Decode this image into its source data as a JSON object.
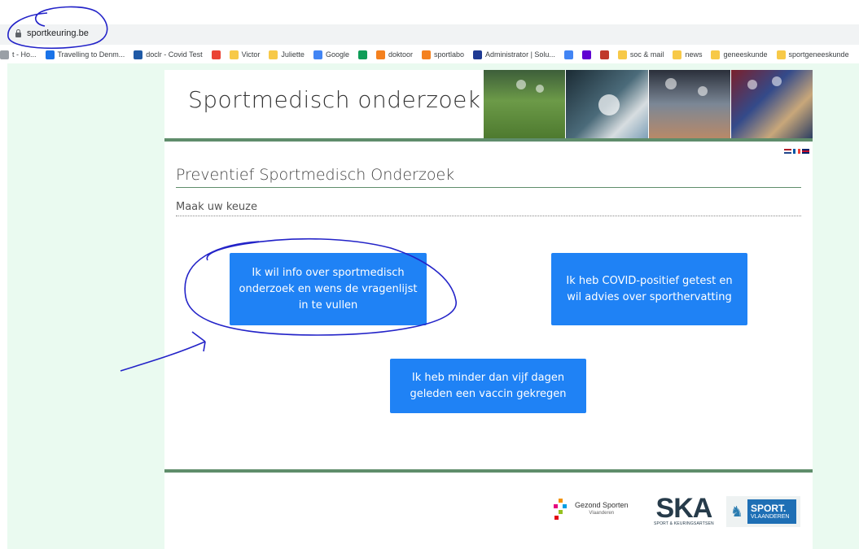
{
  "browser": {
    "url": "sportkeuring.be",
    "bookmarks": [
      {
        "label": "t - Ho...",
        "icon": "bookmark-icon",
        "color": "#9aa0a6"
      },
      {
        "label": "Travelling to Denm...",
        "icon": "globe-icon",
        "color": "#1a73e8"
      },
      {
        "label": "doclr - Covid Test",
        "icon": "doclr-icon",
        "color": "#1f5aa6"
      },
      {
        "label": "",
        "icon": "maps-pin-icon",
        "color": "#ea4335"
      },
      {
        "label": "Victor",
        "icon": "folder-icon",
        "color": "#f7c948"
      },
      {
        "label": "Juliette",
        "icon": "folder-icon",
        "color": "#f7c948"
      },
      {
        "label": "Google",
        "icon": "google-icon",
        "color": "#4285f4"
      },
      {
        "label": "",
        "icon": "plus-box-icon",
        "color": "#0f9d58"
      },
      {
        "label": "doktoor",
        "icon": "doktoor-icon",
        "color": "#f4811f"
      },
      {
        "label": "sportlabo",
        "icon": "sportlabo-icon",
        "color": "#f4811f"
      },
      {
        "label": "Administrator | Solu...",
        "icon": "chevron-right-icon",
        "color": "#1f3a93"
      },
      {
        "label": "",
        "icon": "google-icon",
        "color": "#4285f4"
      },
      {
        "label": "",
        "icon": "yahoo-icon",
        "color": "#6001d2"
      },
      {
        "label": "",
        "icon": "people-icon",
        "color": "#c0392b"
      },
      {
        "label": "soc & mail",
        "icon": "folder-icon",
        "color": "#f7c948"
      },
      {
        "label": "news",
        "icon": "folder-icon",
        "color": "#f7c948"
      },
      {
        "label": "geneeskunde",
        "icon": "folder-icon",
        "color": "#f7c948"
      },
      {
        "label": "sportgeneeskunde",
        "icon": "folder-icon",
        "color": "#f7c948"
      }
    ]
  },
  "site": {
    "title": "Sportmedisch onderzoek",
    "heading": "Preventief Sportmedisch Onderzoek",
    "subheading": "Maak uw keuze",
    "choices": {
      "info": "Ik wil info over sportmedisch onderzoek en wens de vragenlijst in te vullen",
      "covid": "Ik heb COVID-positief getest en wil advies over sporthervatting",
      "vaccine": "Ik heb minder dan vijf dagen geleden een vaccin gekregen"
    },
    "accent_color": "#1f82f5",
    "bar_color": "#5f8d6b"
  },
  "footer": {
    "gezond_sporten": "Gezond Sporten",
    "gezond_sporten_sub": "Vlaanderen",
    "ska": "SKA",
    "ska_sub": "SPORT & KEURINGSARTSEN",
    "sport_vlaanderen_1": "SPORT.",
    "sport_vlaanderen_2": "VLAANDEREN"
  }
}
